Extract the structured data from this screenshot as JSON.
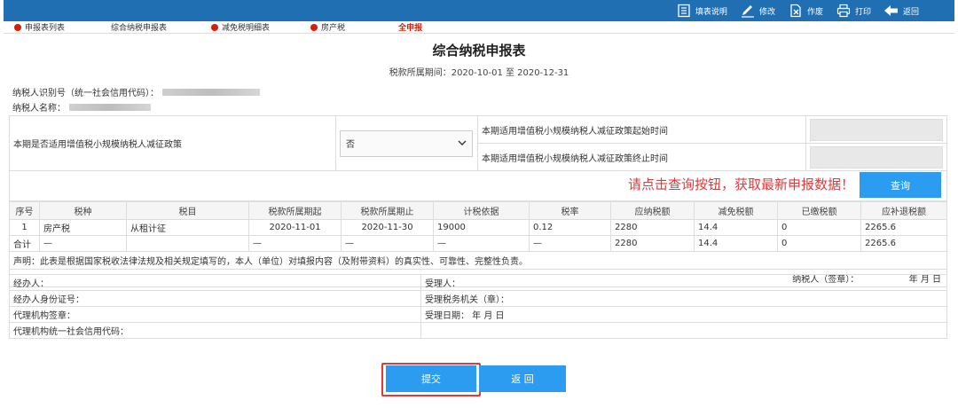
{
  "toolbar": {
    "items": [
      {
        "label": "填表说明",
        "icon": "document-list-icon"
      },
      {
        "label": "修改",
        "icon": "pencil-icon"
      },
      {
        "label": "作废",
        "icon": "document-cancel-icon"
      },
      {
        "label": "打印",
        "icon": "printer-icon"
      },
      {
        "label": "返回",
        "icon": "arrow-left-icon"
      }
    ]
  },
  "tabs": [
    {
      "label": "申报表列表",
      "has_dot": true
    },
    {
      "label": "综合纳税申报表",
      "has_dot": false
    },
    {
      "label": "减免税明细表",
      "has_dot": true
    },
    {
      "label": "房产税",
      "has_dot": true
    },
    {
      "label": "全申报",
      "has_dot": false,
      "active": true
    }
  ],
  "form": {
    "title": "综合纳税申报表",
    "period_label": "税款所属期间：",
    "period_value": "2020-10-01 至 2020-12-31",
    "taxpayer_id_label": "纳税人识别号（统一社会信用代码）：",
    "taxpayer_name_label": "纳税人名称："
  },
  "policy": {
    "question": "本期是否适用增值税小规模纳税人减征政策",
    "select_value": "否",
    "start_label": "本期适用增值税小规模纳税人减征政策起始时间",
    "end_label": "本期适用增值税小规模纳税人减征政策终止时间"
  },
  "query": {
    "hint": "请点击查询按钮，获取最新申报数据！",
    "button": "查询"
  },
  "table": {
    "headers": [
      "序号",
      "税种",
      "税目",
      "税款所属期起",
      "税款所属期止",
      "计税依据",
      "税率",
      "应纳税额",
      "减免税额",
      "已缴税额",
      "应补退税额"
    ],
    "rows": [
      [
        "1",
        "房产税",
        "从租计征",
        "2020-11-01",
        "2020-11-30",
        "19000",
        "0.12",
        "2280",
        "14.4",
        "0",
        "2265.6"
      ],
      [
        "合计",
        "—",
        "",
        "—",
        "—",
        "—",
        "—",
        "2280",
        "14.4",
        "0",
        "2265.6"
      ]
    ],
    "declaration": "声明：此表是根据国家税收法律法规及相关规定填写的，本人（单位）对填报内容（及附带资料）的真实性、可靠性、完整性负责。",
    "sign_label": "纳税人（签章）：",
    "sign_date": "年 月 日"
  },
  "signature": {
    "agent": "经办人：",
    "receiver": "受理人：",
    "agent_id": "经办人身份证号：",
    "tax_office": "受理税务机关（章）：",
    "agency_seal": "代理机构签章：",
    "receive_date": "受理日期：  年 月 日",
    "agency_credit_code": "代理机构统一社会信用代码："
  },
  "buttons": {
    "submit": "提交",
    "back": "返 回"
  },
  "colors": {
    "topbar": "#1f6fb2",
    "accent": "#2b9cf0",
    "alert": "#e4393c",
    "tab_dot": "#d81e06"
  }
}
